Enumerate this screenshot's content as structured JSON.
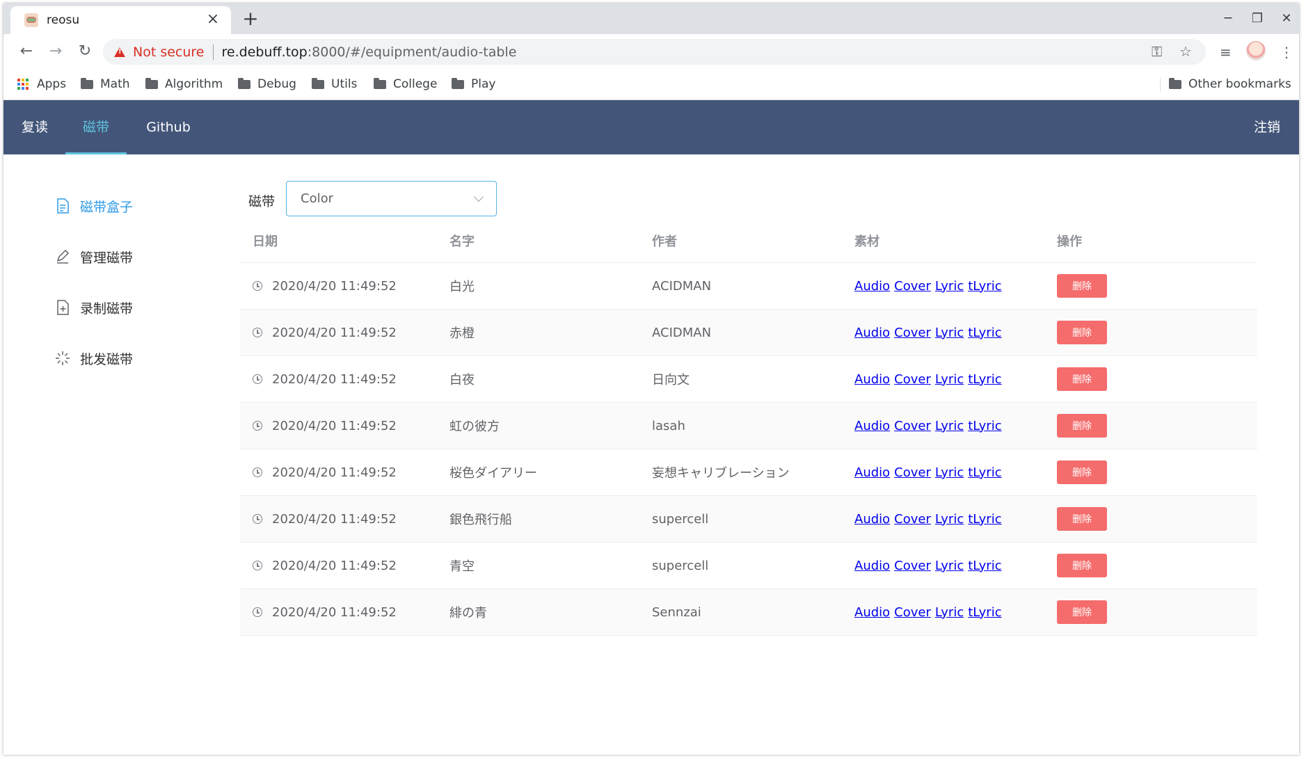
{
  "browser": {
    "tab_title": "reosu",
    "security_text": "Not secure",
    "url_host": "re.debuff.top",
    "url_path": ":8000/#/equipment/audio-table",
    "bookmarks": [
      "Apps",
      "Math",
      "Algorithm",
      "Debug",
      "Utils",
      "College",
      "Play"
    ],
    "other_bookmarks": "Other bookmarks"
  },
  "header": {
    "nav": [
      "复读",
      "磁带",
      "Github"
    ],
    "active_nav": "磁带",
    "logout": "注销",
    "bg_color": "#435679",
    "accent_color": "#5fc2dd"
  },
  "sidebar": {
    "items": [
      {
        "label": "磁带盒子",
        "icon": "document-icon",
        "active": true
      },
      {
        "label": "管理磁带",
        "icon": "edit-icon",
        "active": false
      },
      {
        "label": "录制磁带",
        "icon": "document-add-icon",
        "active": false
      },
      {
        "label": "批发磁带",
        "icon": "loading-icon",
        "active": false
      }
    ]
  },
  "filter": {
    "label": "磁带",
    "selected": "Color"
  },
  "table": {
    "headers": [
      "日期",
      "名字",
      "作者",
      "素材",
      "操作"
    ],
    "link_labels": [
      "Audio",
      "Cover",
      "Lyric",
      "tLyric"
    ],
    "delete_label": "删除",
    "rows": [
      {
        "date": "2020/4/20 11:49:52",
        "name": "白光",
        "author": "ACIDMAN"
      },
      {
        "date": "2020/4/20 11:49:52",
        "name": "赤橙",
        "author": "ACIDMAN"
      },
      {
        "date": "2020/4/20 11:49:52",
        "name": "白夜",
        "author": "日向文"
      },
      {
        "date": "2020/4/20 11:49:52",
        "name": "虹の彼方",
        "author": "lasah"
      },
      {
        "date": "2020/4/20 11:49:52",
        "name": "桜色ダイアリー",
        "author": "妄想キャリブレーション"
      },
      {
        "date": "2020/4/20 11:49:52",
        "name": "銀色飛行船",
        "author": "supercell"
      },
      {
        "date": "2020/4/20 11:49:52",
        "name": "青空",
        "author": "supercell"
      },
      {
        "date": "2020/4/20 11:49:52",
        "name": "緋の青",
        "author": "Sennzai"
      }
    ]
  }
}
